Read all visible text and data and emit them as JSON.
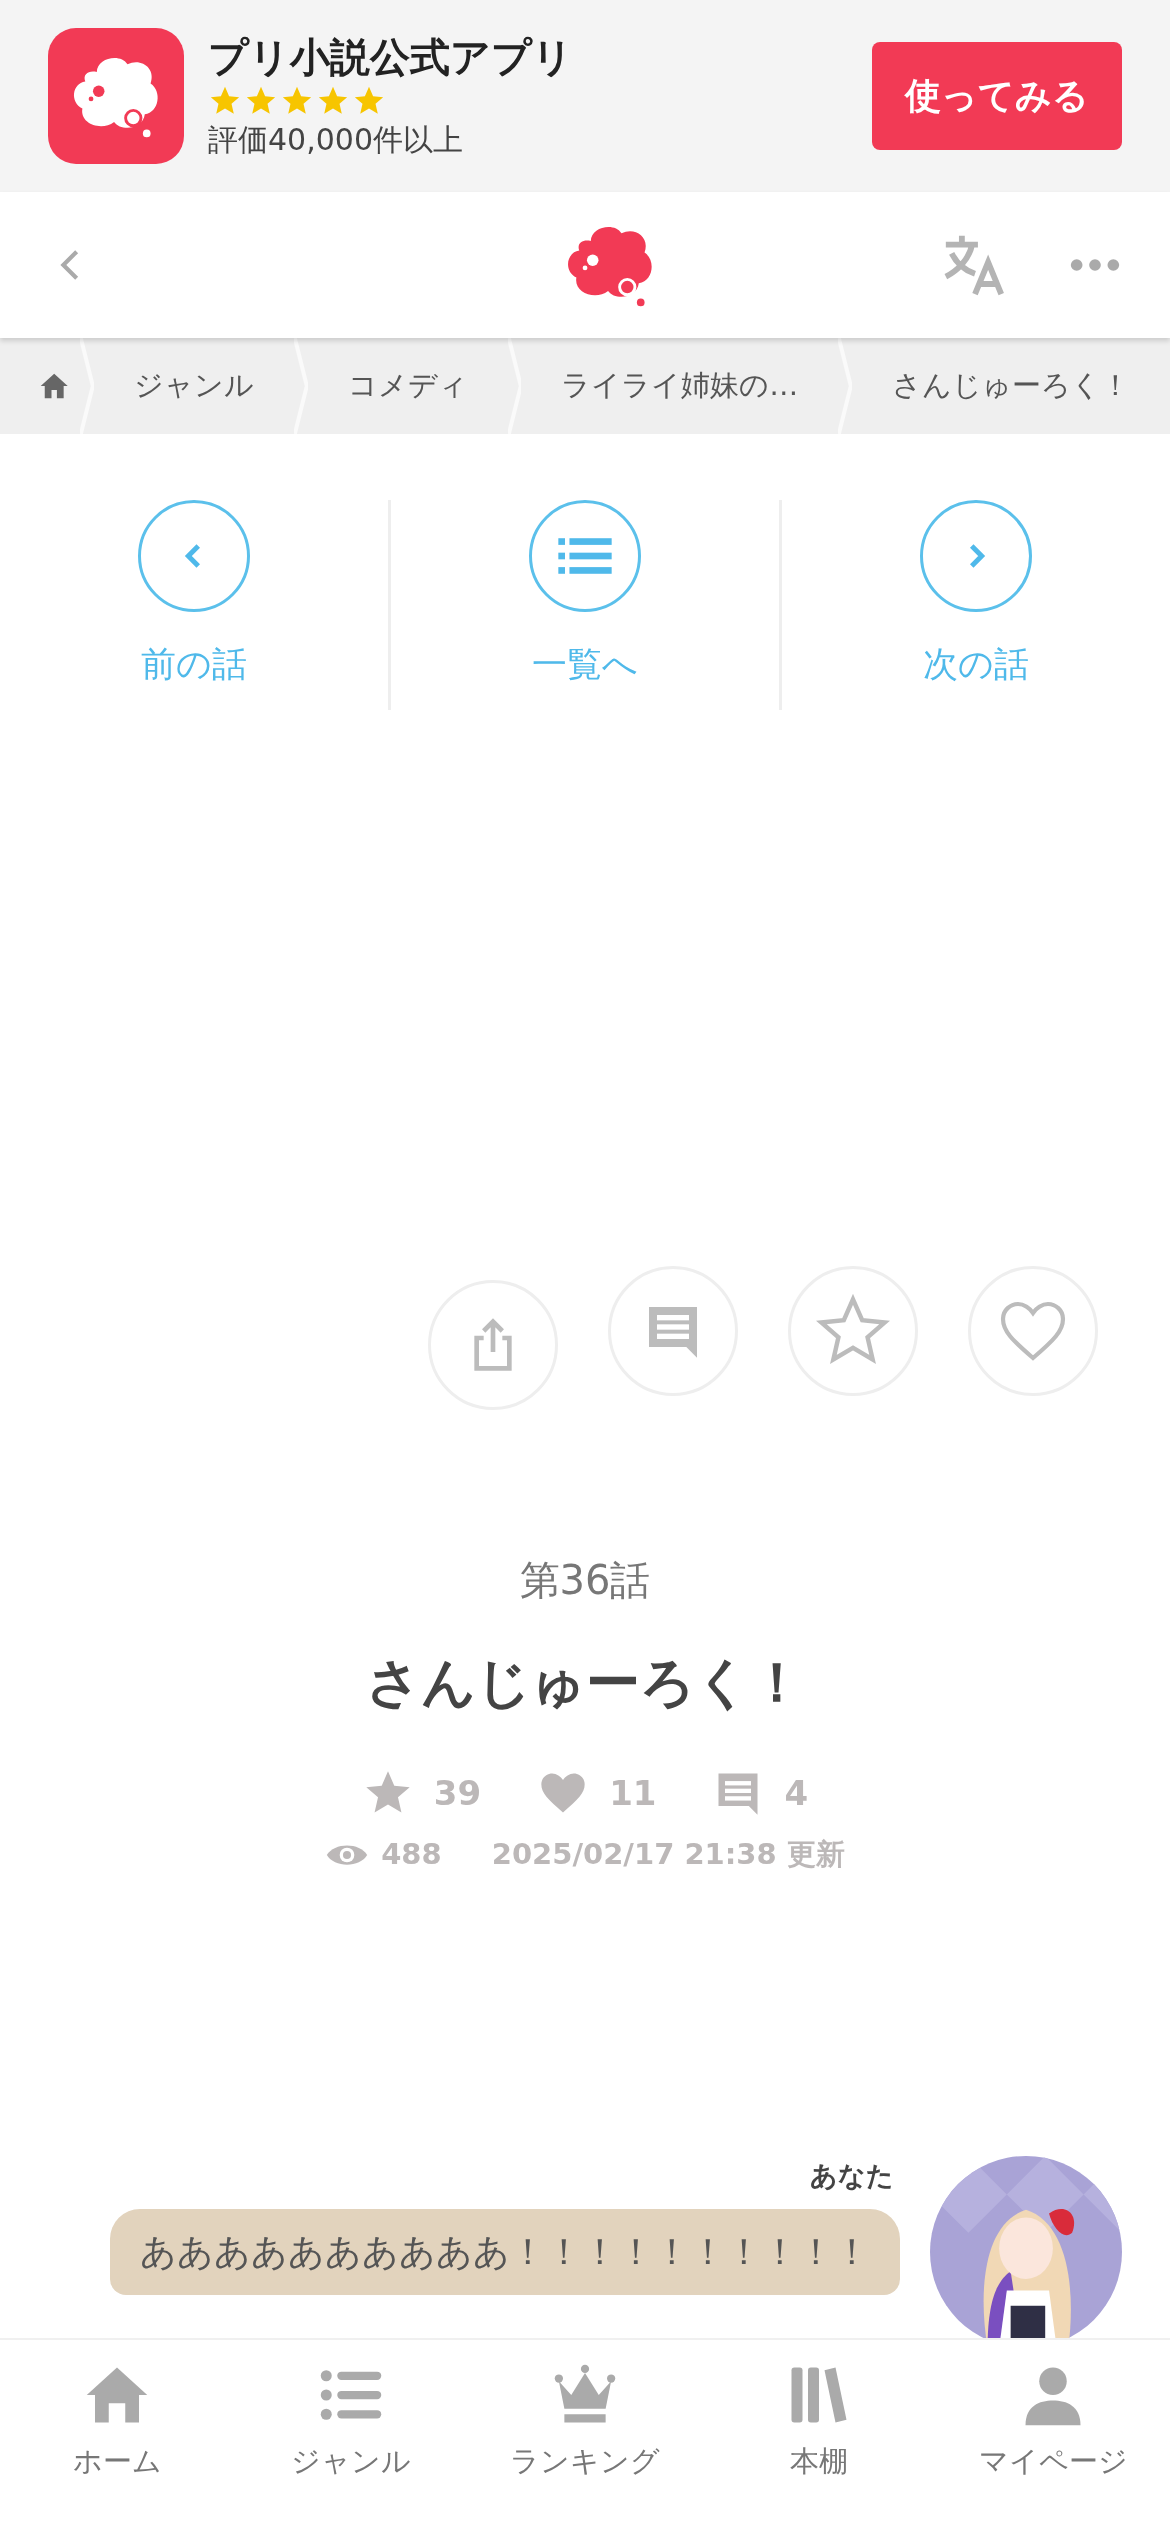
{
  "banner": {
    "app_name": "プリ小説公式アプリ",
    "stars": 5,
    "rating_text": "評価40,000件以上",
    "button": "使ってみる"
  },
  "breadcrumb": [
    {
      "label": "ジャンル"
    },
    {
      "label": "コメディ"
    },
    {
      "label": "ライライ姉妹の…"
    },
    {
      "label": "さんじゅーろく！"
    }
  ],
  "episode_nav": [
    {
      "kind": "prev",
      "label": "前の話"
    },
    {
      "kind": "list",
      "label": "一覧へ"
    },
    {
      "kind": "next",
      "label": "次の話"
    }
  ],
  "episode": {
    "number": "第36話",
    "title": "さんじゅーろく！",
    "stats": [
      {
        "kind": "star",
        "value": "39"
      },
      {
        "kind": "heart",
        "value": "11"
      },
      {
        "kind": "comment",
        "value": "4"
      }
    ],
    "views": "488",
    "updated": "2025/02/17 21:38 更新"
  },
  "comment": {
    "author": "あなた",
    "text": "ああああああああああ！！！！！！！！！！"
  },
  "tab_bar": [
    {
      "kind": "home",
      "label": "ホーム"
    },
    {
      "kind": "genre",
      "label": "ジャンル"
    },
    {
      "kind": "ranking",
      "label": "ランキング"
    },
    {
      "kind": "shelf",
      "label": "本棚"
    },
    {
      "kind": "mypage",
      "label": "マイページ"
    }
  ]
}
